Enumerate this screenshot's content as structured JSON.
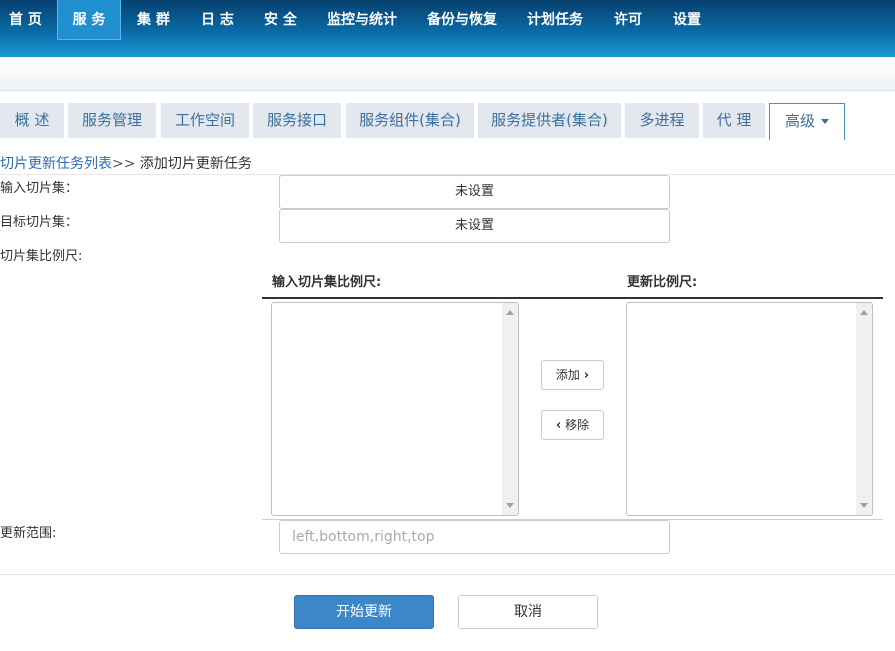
{
  "topnav": {
    "items": [
      "首 页",
      "服 务",
      "集 群",
      "日 志",
      "安 全",
      "监控与统计",
      "备份与恢复",
      "计划任务",
      "许可",
      "设置"
    ],
    "active": "服 务"
  },
  "tabs": {
    "items": [
      "概 述",
      "服务管理",
      "工作空间",
      "服务接口",
      "服务组件(集合)",
      "服务提供者(集合)",
      "多进程",
      "代 理",
      "高级"
    ],
    "active": "高级"
  },
  "breadcrumb": {
    "parent": "切片更新任务列表",
    "separator": ">>",
    "current": "添加切片更新任务"
  },
  "form": {
    "input_tileset_label": "输入切片集：",
    "input_tileset_value": "未设置",
    "target_tileset_label": "目标切片集：",
    "target_tileset_value": "未设置",
    "scales_label": "切片集比例尺:",
    "input_scales_header": "输入切片集比例尺:",
    "update_scales_header": "更新比例尺:",
    "add_button": "添加",
    "remove_button": "移除",
    "range_label": "更新范围:",
    "range_placeholder": "left,bottom,right,top",
    "range_value": ""
  },
  "actions": {
    "start": "开始更新",
    "cancel": "取消"
  },
  "colors": {
    "nav_top": "#06406e",
    "nav_bottom": "#1a9bd8",
    "primary_button": "#3b87c7",
    "link": "#2b6cb0"
  }
}
